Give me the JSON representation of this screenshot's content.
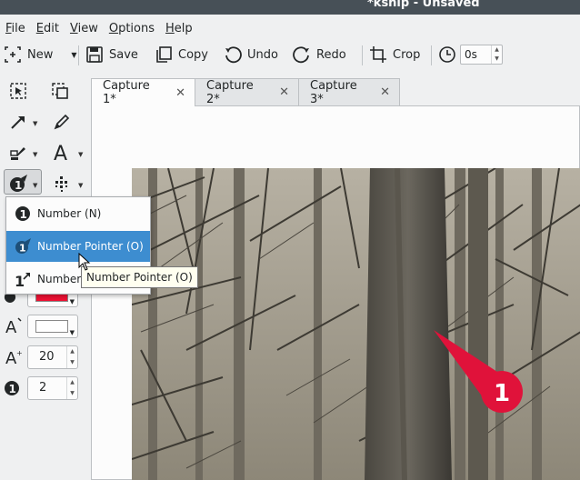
{
  "window": {
    "title": "*ksnip - Unsaved"
  },
  "menu": [
    {
      "first": "F",
      "rest": "ile"
    },
    {
      "first": "E",
      "rest": "dit"
    },
    {
      "first": "V",
      "rest": "iew"
    },
    {
      "first": "O",
      "rest": "ptions"
    },
    {
      "first": "H",
      "rest": "elp"
    }
  ],
  "toolbar": {
    "new_label": "New",
    "save_label": "Save",
    "copy_label": "Copy",
    "undo_label": "Undo",
    "redo_label": "Redo",
    "crop_label": "Crop",
    "delay_value": "0s"
  },
  "tabs": [
    {
      "label": "Capture 1*"
    },
    {
      "label": "Capture 2*"
    },
    {
      "label": "Capture 3*"
    }
  ],
  "number_menu": {
    "items": [
      {
        "label": "Number (N)",
        "icon": "number-icon"
      },
      {
        "label": "Number Pointer (O)",
        "icon": "number-pointer-icon"
      },
      {
        "label": "Number",
        "icon": "number-arrow-icon"
      }
    ]
  },
  "tooltip": "Number Pointer (O)",
  "properties": {
    "color": "#ee1133",
    "text_color": "#ffffff",
    "font_size": "20",
    "number_start": "2"
  },
  "canvas": {
    "badge_number": "1",
    "badge_color": "#e0123a"
  }
}
